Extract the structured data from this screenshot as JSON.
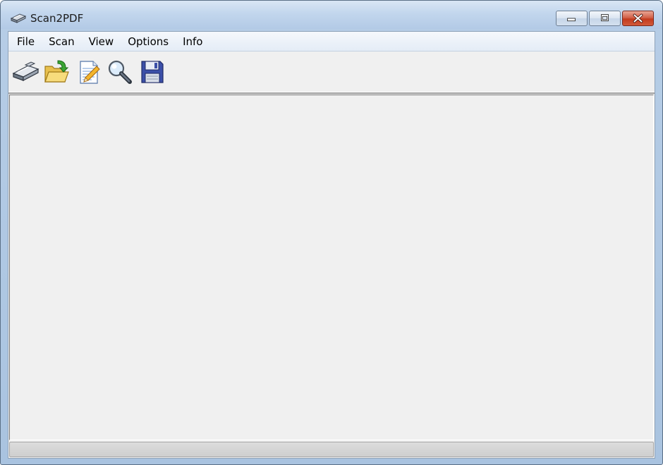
{
  "window": {
    "title": "Scan2PDF"
  },
  "menu": [
    {
      "label": "File"
    },
    {
      "label": "Scan"
    },
    {
      "label": "View"
    },
    {
      "label": "Options"
    },
    {
      "label": "Info"
    }
  ],
  "toolbar": {
    "buttons": [
      {
        "icon": "scanner-icon"
      },
      {
        "icon": "open-folder-icon"
      },
      {
        "icon": "edit-document-icon"
      },
      {
        "icon": "magnifier-icon"
      },
      {
        "icon": "floppy-disk-icon"
      }
    ]
  },
  "statusbar": {
    "text": ""
  },
  "colors": {
    "titlebar": "#c2d6ed",
    "client_bg": "#f0f0f0",
    "close_button": "#c33b1e"
  }
}
